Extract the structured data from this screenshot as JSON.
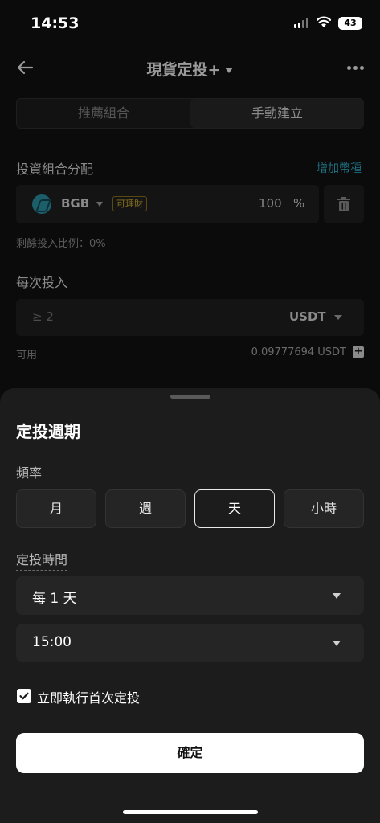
{
  "status_bar": {
    "time": "14:53",
    "battery": "43"
  },
  "header": {
    "title": "現貨定投+"
  },
  "mode_tabs": [
    {
      "label": "推薦組合"
    },
    {
      "label": "手動建立"
    }
  ],
  "portfolio": {
    "label": "投資組合分配",
    "add_link": "增加幣種",
    "coin": {
      "name": "BGB",
      "badge": "可理財",
      "percent": "100",
      "percent_sign": "%"
    },
    "remaining": "剩餘投入比例：0%"
  },
  "per_investment": {
    "label": "每次投入",
    "placeholder": "≥ 2",
    "unit": "USDT",
    "available_label": "可用",
    "available_value": "0.09777694 USDT"
  },
  "sheet": {
    "title": "定投週期",
    "frequency_label": "頻率",
    "frequencies": [
      {
        "label": "月",
        "selected": false
      },
      {
        "label": "週",
        "selected": false
      },
      {
        "label": "天",
        "selected": true
      },
      {
        "label": "小時",
        "selected": false
      }
    ],
    "time_label": "定投時間",
    "interval_value": "每 1 天",
    "time_value": "15:00",
    "execute_now_label": "立即執行首次定投",
    "execute_now_checked": true,
    "confirm_label": "確定"
  }
}
